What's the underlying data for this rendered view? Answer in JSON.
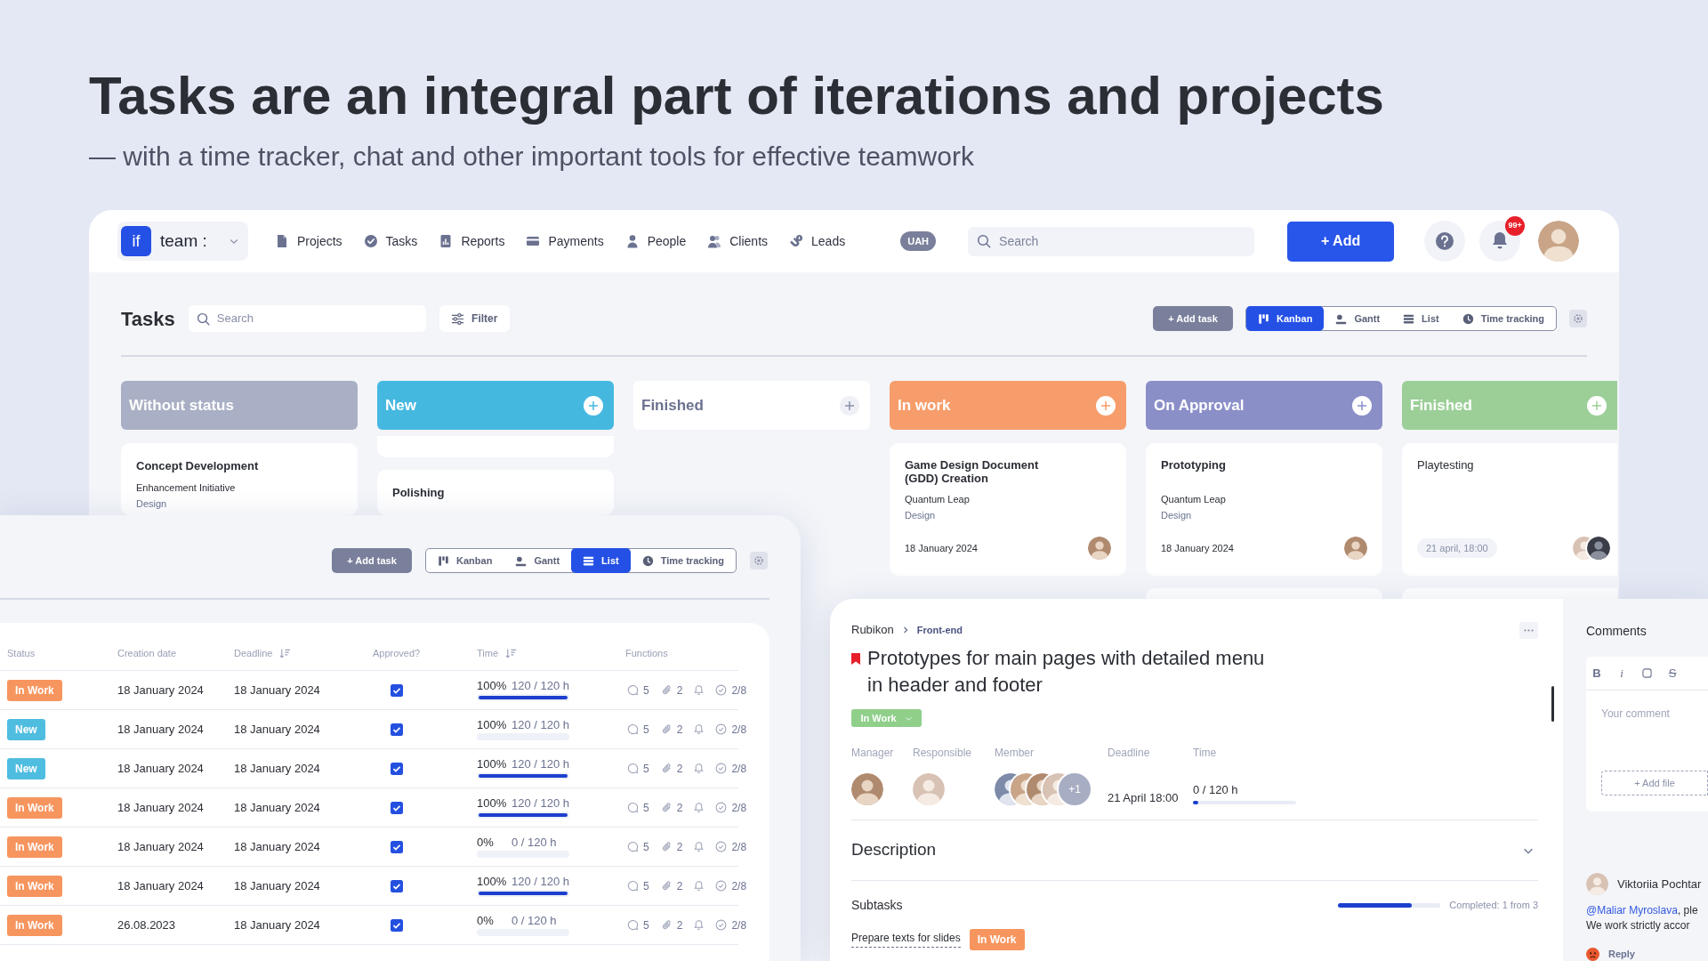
{
  "headline": {
    "title": "Tasks are an integral part of iterations and projects",
    "subtitle": "— with a time tracker, chat and other important tools for effective teamwork"
  },
  "top_bar": {
    "logo": "if",
    "workspace": "team :",
    "nav": [
      "Projects",
      "Tasks",
      "Reports",
      "Payments",
      "People",
      "Clients",
      "Leads"
    ],
    "currency": "UAH",
    "search": {
      "placeholder": "Search"
    },
    "add_button": "+ Add",
    "notifications": "99+"
  },
  "tasks_view": {
    "title": "Tasks",
    "search": {
      "placeholder": "Search"
    },
    "filter": "Filter",
    "add_task": "+ Add task",
    "views": [
      {
        "label": "Kanban",
        "selected": true
      },
      {
        "label": "Gantt",
        "selected": false
      },
      {
        "label": "List",
        "selected": false
      },
      {
        "label": "Time tracking",
        "selected": false
      }
    ],
    "columns": [
      {
        "title": "Without status",
        "kind": "filled",
        "color": "#a9afc4",
        "add": false,
        "cards": [
          {
            "kind": "basic",
            "title": "Concept Development",
            "project": "Enhancement Initiative",
            "tag": "Design"
          }
        ]
      },
      {
        "title": "New",
        "kind": "filled",
        "color": "#45b8e0",
        "add": true,
        "cards": [
          {
            "kind": "stub"
          },
          {
            "kind": "basic",
            "title": "Polishing"
          }
        ]
      },
      {
        "title": "Finished",
        "kind": "plain",
        "add": true
      },
      {
        "title": "In work",
        "kind": "filled",
        "color": "#f79d6b",
        "add": true,
        "cards": [
          {
            "kind": "dated",
            "title": "Game Design Document (GDD) Creation",
            "project": "Quantum Leap",
            "tag": "Design",
            "date": "18 January 2024"
          }
        ]
      },
      {
        "title": "On Approval",
        "kind": "filled",
        "color": "#8b8fc8",
        "add": true,
        "cards": [
          {
            "kind": "dated",
            "title": "Prototyping",
            "project": "Quantum Leap",
            "tag": "Design",
            "date": "18 January 2024"
          },
          {
            "kind": "stub"
          }
        ]
      },
      {
        "title": "Finished",
        "kind": "filled",
        "color": "#9ccf98",
        "add": true,
        "cards": [
          {
            "kind": "scheduled",
            "title": "Playtesting",
            "date": "21 april, 18:00"
          },
          {
            "kind": "stub"
          }
        ]
      }
    ]
  },
  "list_view": {
    "add_task": "+ Add task",
    "views": [
      {
        "label": "Kanban",
        "selected": false
      },
      {
        "label": "Gantt",
        "selected": false
      },
      {
        "label": "List",
        "selected": true
      },
      {
        "label": "Time tracking",
        "selected": false
      }
    ],
    "columns": [
      {
        "label": "Status",
        "sortable": false
      },
      {
        "label": "Creation date",
        "sortable": false
      },
      {
        "label": "Deadline",
        "sortable": true
      },
      {
        "label": "Approved?",
        "sortable": false
      },
      {
        "label": "Time",
        "sortable": true
      },
      {
        "label": "Functions",
        "sortable": false
      }
    ],
    "rows": [
      {
        "status": {
          "label": "In Work",
          "color": "#f7955f"
        },
        "created": "18 January 2024",
        "deadline": "18 January 2024",
        "approved": true,
        "percent": "100%",
        "hours": "120 / 120 h",
        "level": 1,
        "comments": "5",
        "attachments": "2",
        "checklist": "2/8"
      },
      {
        "status": {
          "label": "New",
          "color": "#4fbde0"
        },
        "created": "18 January 2024",
        "deadline": "18 January 2024",
        "approved": true,
        "percent": "100%",
        "hours": "120 / 120 h",
        "level": 0,
        "comments": "5",
        "attachments": "2",
        "checklist": "2/8"
      },
      {
        "status": {
          "label": "New",
          "color": "#4fbde0"
        },
        "created": "18 January 2024",
        "deadline": "18 January 2024",
        "approved": true,
        "percent": "100%",
        "hours": "120 / 120 h",
        "level": 1,
        "comments": "5",
        "attachments": "2",
        "checklist": "2/8"
      },
      {
        "status": {
          "label": "In Work",
          "color": "#f7955f"
        },
        "created": "18 January 2024",
        "deadline": "18 January 2024",
        "approved": true,
        "percent": "100%",
        "hours": "120 / 120 h",
        "level": 1,
        "comments": "5",
        "attachments": "2",
        "checklist": "2/8"
      },
      {
        "status": {
          "label": "In Work",
          "color": "#f7955f"
        },
        "created": "18 January 2024",
        "deadline": "18 January 2024",
        "approved": true,
        "percent": "0%",
        "hours": "0 / 120 h",
        "level": 0,
        "comments": "5",
        "attachments": "2",
        "checklist": "2/8"
      },
      {
        "status": {
          "label": "In Work",
          "color": "#f7955f"
        },
        "created": "18 January 2024",
        "deadline": "18 January 2024",
        "approved": true,
        "percent": "100%",
        "hours": "120 / 120 h",
        "level": 1,
        "comments": "5",
        "attachments": "2",
        "checklist": "2/8"
      },
      {
        "status": {
          "label": "In Work",
          "color": "#f7955f"
        },
        "created": "26.08.2023",
        "deadline": "18 January 2024",
        "approved": true,
        "percent": "0%",
        "hours": "0 / 120 h",
        "level": 0,
        "comments": "5",
        "attachments": "2",
        "checklist": "2/8"
      }
    ]
  },
  "task_detail": {
    "breadcrumb": [
      "Rubikon",
      "Front-end"
    ],
    "flagged": true,
    "title": "Prototypes for main pages with detailed menu in header and footer",
    "status": {
      "label": "In Work",
      "color": "#8fcf8a"
    },
    "labels": [
      "Manager",
      "Responsible",
      "Member",
      "Deadline",
      "Time"
    ],
    "extra_members": "+1",
    "deadline": "21 April 18:00",
    "time": {
      "text": "0 / 120 h",
      "level": 0.05
    },
    "description": "Description",
    "subtasks": {
      "title": "Subtasks",
      "progress": {
        "level": 0.72,
        "text": "Completed: 1 from 3"
      },
      "items": [
        {
          "title": "Prepare texts for slides",
          "status": {
            "label": "In Work",
            "color": "#f7955f"
          }
        }
      ]
    }
  },
  "comments": {
    "title": "Comments",
    "toolbar": [
      {
        "kind": "bold",
        "label": "B"
      },
      {
        "kind": "italic",
        "label": "i"
      },
      {
        "kind": "box"
      },
      {
        "kind": "strike",
        "label": "S"
      }
    ],
    "placeholder": "Your comment",
    "add_file": "+ Add file",
    "comment": {
      "author": "Viktoriia Pochtar",
      "mention": "@Maliar Myroslava",
      "text": ", ple",
      "text_2": "We work strictly accor",
      "reply": "Reply"
    }
  }
}
